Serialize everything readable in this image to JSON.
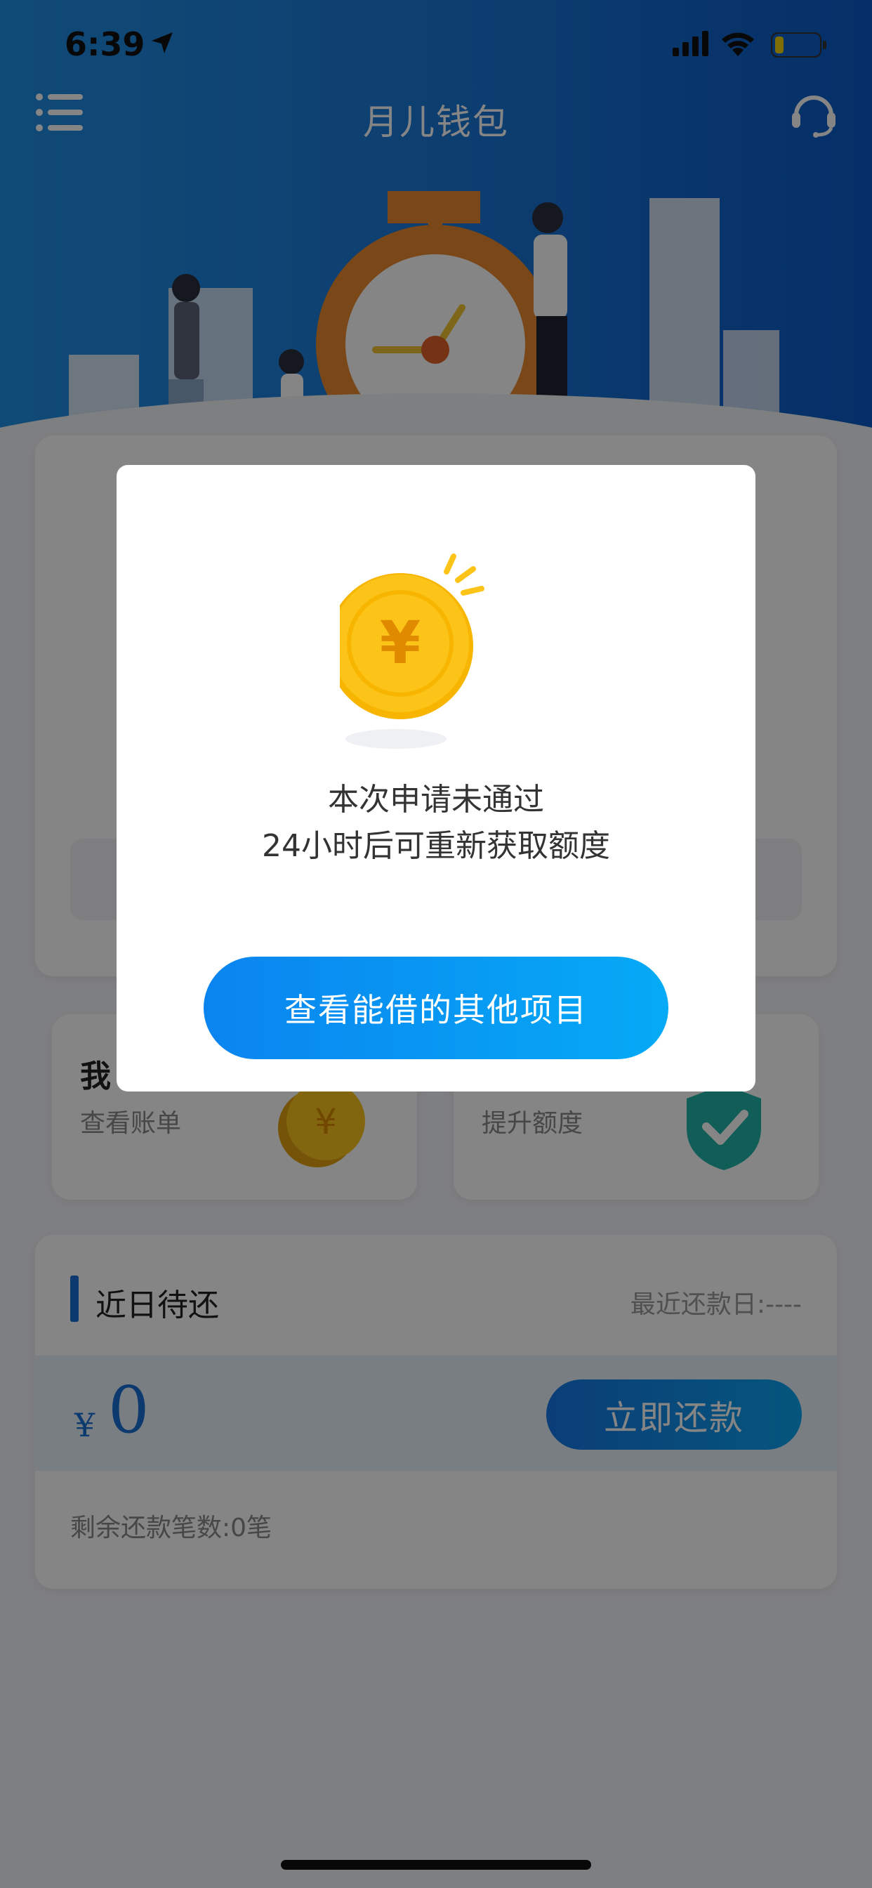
{
  "status_bar": {
    "time": "6:39",
    "icons": [
      "location-arrow-icon",
      "signal-icon",
      "wifi-icon",
      "battery-icon"
    ]
  },
  "header": {
    "title": "月儿钱包",
    "menu_icon": "menu-list-icon",
    "support_icon": "customer-service-icon"
  },
  "cards": {
    "bill": {
      "title": "我",
      "subtitle": "查看账单",
      "icon": "coin-icon"
    },
    "credit": {
      "subtitle": "提升额度",
      "icon": "shield-check-icon"
    }
  },
  "repayment": {
    "title": "近日待还",
    "recent_date": "最近还款日:----",
    "currency": "¥",
    "amount": "0",
    "button_label": "立即还款",
    "remaining": "剩余还款笔数:0笔"
  },
  "modal": {
    "message_line1": "本次申请未通过",
    "message_line2": "24小时后可重新获取额度",
    "button_label": "查看能借的其他项目",
    "icon": "gold-coin-yen-icon"
  },
  "colors": {
    "header_blue": "#1a76d6",
    "accent_blue": "#1a6fd4",
    "button_gradient_start": "#0a84ef",
    "button_gradient_end": "#06aaf6",
    "coin_gold": "#fcc419"
  }
}
